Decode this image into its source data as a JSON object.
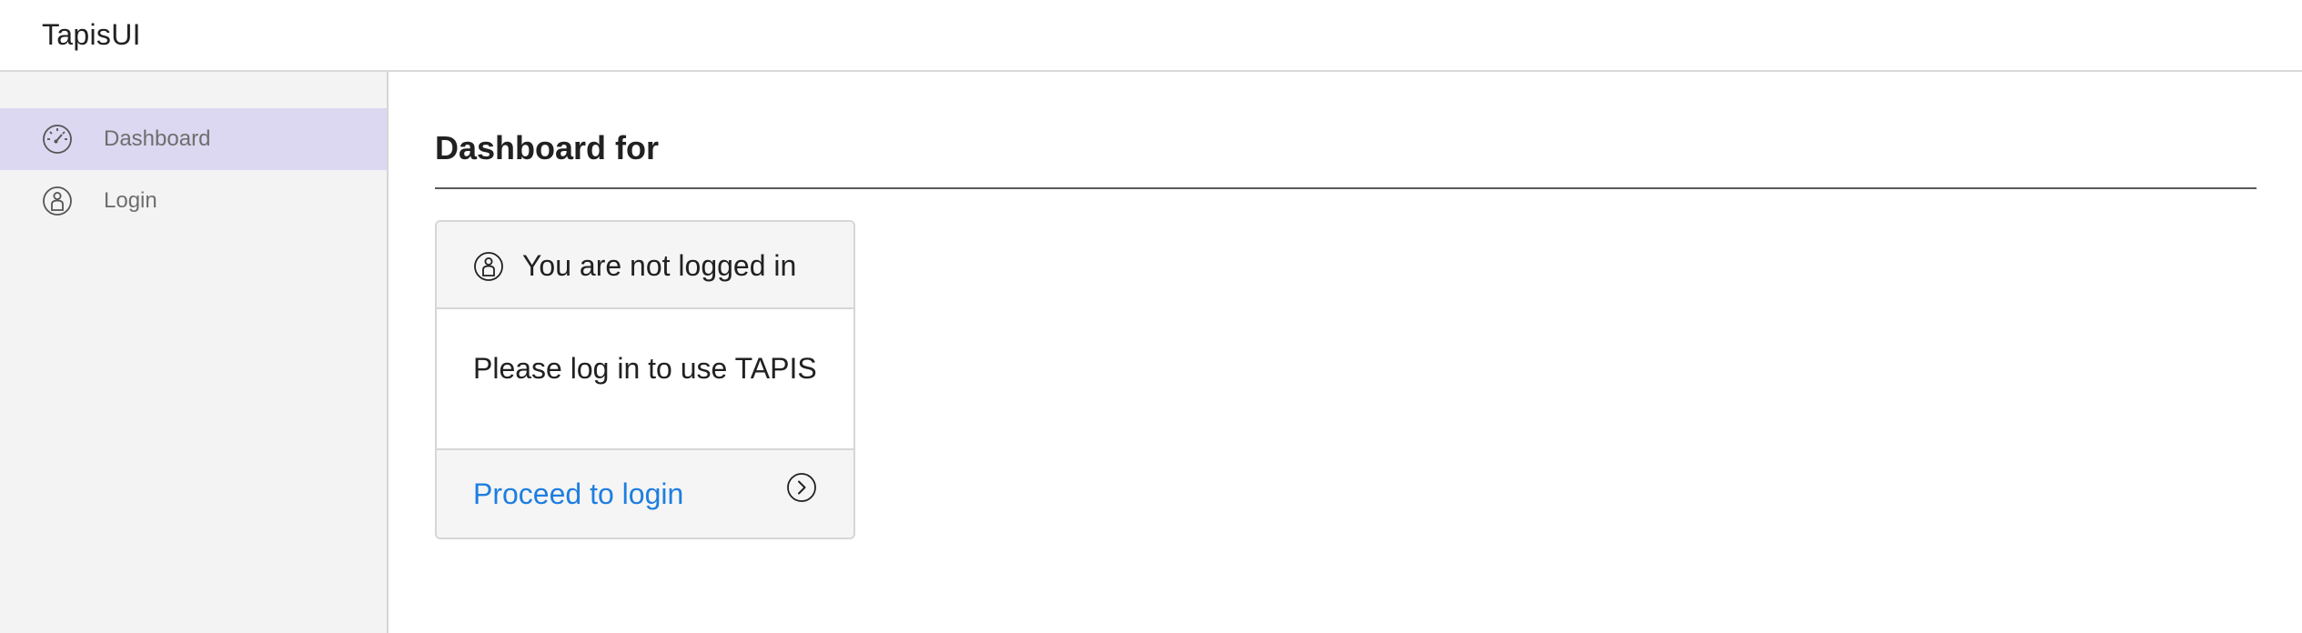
{
  "app": {
    "title": "TapisUI"
  },
  "sidebar": {
    "items": [
      {
        "label": "Dashboard",
        "icon": "dashboard-icon",
        "active": true
      },
      {
        "label": "Login",
        "icon": "user-circle-icon",
        "active": false
      }
    ],
    "active_color": "#ddd8f1",
    "background": "#f3f3f3"
  },
  "main": {
    "title": "Dashboard for",
    "card": {
      "header": {
        "icon": "user-circle-icon",
        "text": "You are not logged in"
      },
      "body": {
        "text": "Please log in to use TAPIS"
      },
      "footer": {
        "link_text": "Proceed to login",
        "icon": "chevron-right-circle-icon",
        "link_color": "#1e7ee0"
      }
    }
  }
}
